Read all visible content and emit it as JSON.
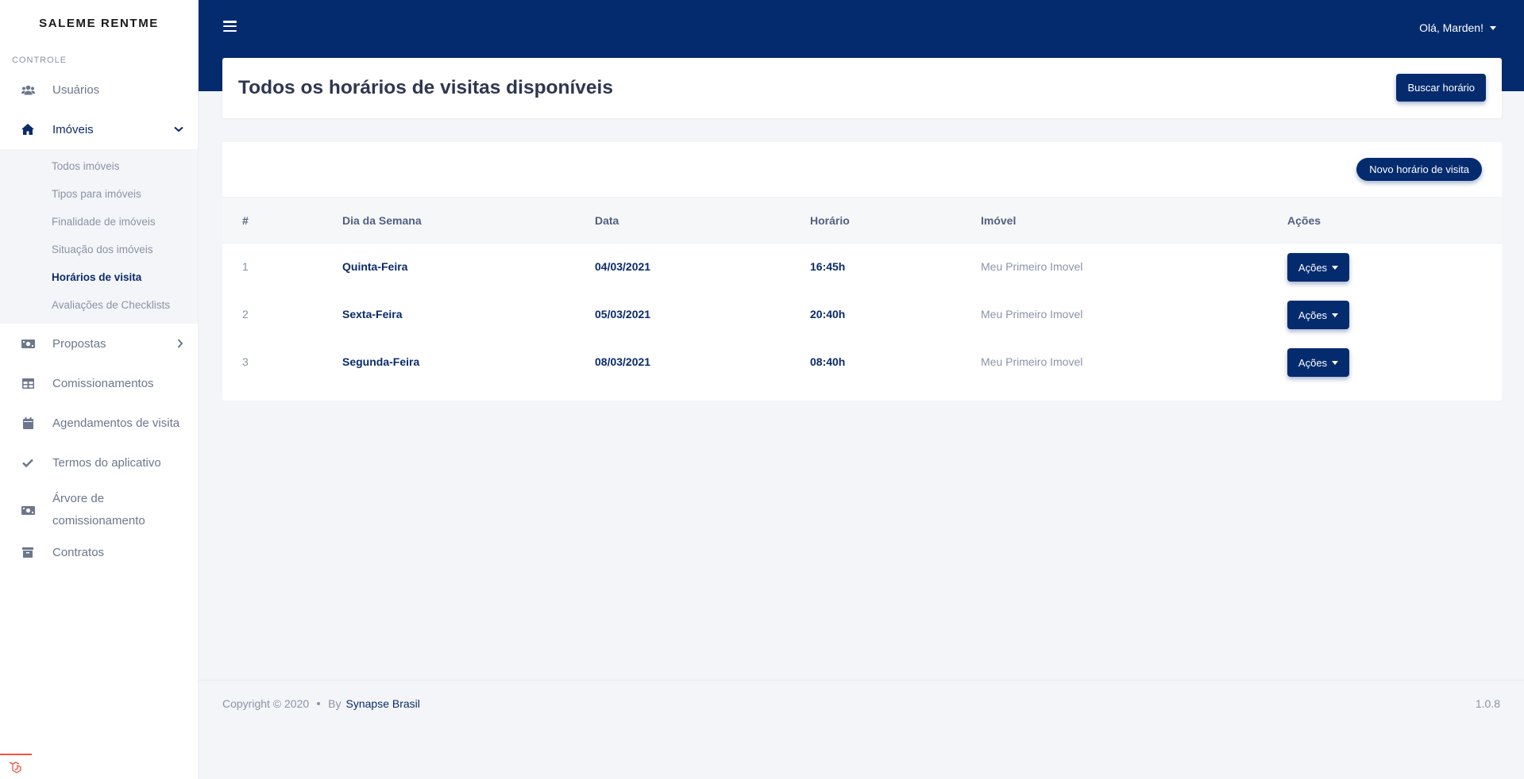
{
  "brand": "SALEME RENTME",
  "sidebar": {
    "section_label": "CONTROLE",
    "items": [
      {
        "label": "Usuários",
        "icon": "users-icon"
      },
      {
        "label": "Imóveis",
        "icon": "home-icon"
      },
      {
        "label": "Propostas",
        "icon": "money-bill-icon"
      },
      {
        "label": "Comissionamentos",
        "icon": "table-icon"
      },
      {
        "label": "Agendamentos de visita",
        "icon": "calendar-icon"
      },
      {
        "label": "Termos do aplicativo",
        "icon": "check-icon"
      },
      {
        "label": "Árvore de comissionamento",
        "icon": "money-bill-icon"
      },
      {
        "label": "Contratos",
        "icon": "archive-icon"
      }
    ],
    "submenu": [
      {
        "label": "Todos imóveis"
      },
      {
        "label": "Tipos para imóveis"
      },
      {
        "label": "Finalidade de imóveis"
      },
      {
        "label": "Situação dos imóveis"
      },
      {
        "label": "Horários de visita"
      },
      {
        "label": "Avaliações de Checklists"
      }
    ]
  },
  "topbar": {
    "user_greeting": "Olá, Marden!"
  },
  "header": {
    "title": "Todos os horários de visitas disponíveis",
    "search_button": "Buscar horário"
  },
  "table": {
    "new_button": "Novo horário de visita",
    "columns": [
      "#",
      "Dia da Semana",
      "Data",
      "Horário",
      "Imóvel",
      "Ações"
    ],
    "rows": [
      {
        "num": "1",
        "day": "Quinta-Feira",
        "date": "04/03/2021",
        "time": "16:45h",
        "property": "Meu Primeiro Imovel",
        "action": "Ações"
      },
      {
        "num": "2",
        "day": "Sexta-Feira",
        "date": "05/03/2021",
        "time": "20:40h",
        "property": "Meu Primeiro Imovel",
        "action": "Ações"
      },
      {
        "num": "3",
        "day": "Segunda-Feira",
        "date": "08/03/2021",
        "time": "08:40h",
        "property": "Meu Primeiro Imovel",
        "action": "Ações"
      }
    ]
  },
  "footer": {
    "copyright": "Copyright © 2020",
    "by": "By",
    "company": "Synapse Brasil",
    "version": "1.0.8"
  },
  "colors": {
    "primary": "#052b6f",
    "background": "#f4f5f8",
    "muted": "#8a93a6",
    "laravel": "#f05340"
  }
}
